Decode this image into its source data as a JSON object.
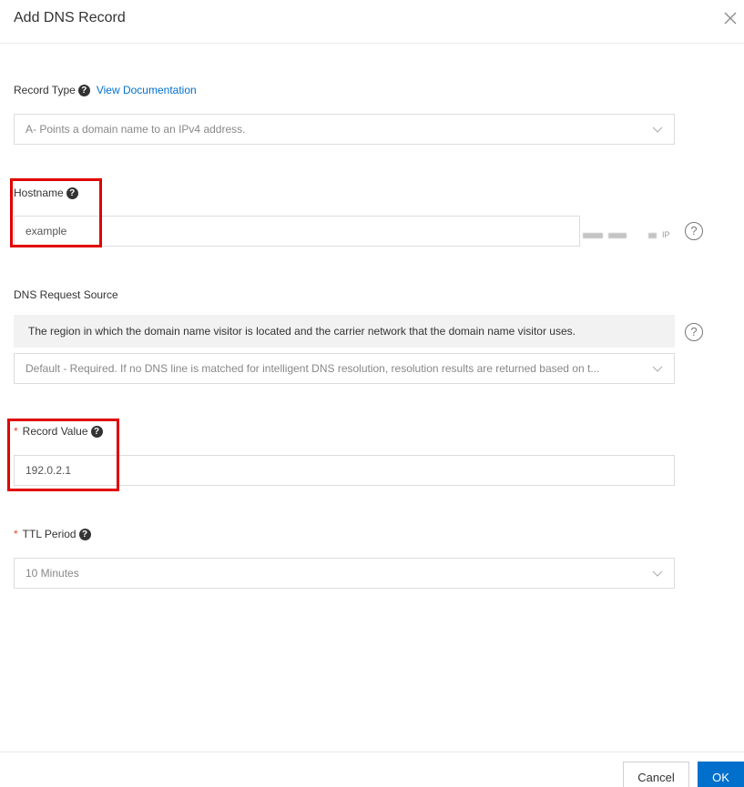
{
  "dialog": {
    "title": "Add DNS Record"
  },
  "record_type": {
    "label": "Record Type",
    "help_link": "View Documentation",
    "selected": "A- Points a domain name to an IPv4 address."
  },
  "hostname": {
    "label": "Hostname",
    "value": "example",
    "suffix": "IP"
  },
  "dns_request_source": {
    "label": "DNS Request Source",
    "info": "The region in which the domain name visitor is located and the carrier network that the domain name visitor uses.",
    "selected": "Default - Required. If no DNS line is matched for intelligent DNS resolution, resolution results are returned based on t..."
  },
  "record_value": {
    "required_mark": "*",
    "label": "Record Value",
    "value": "192.0.2.1"
  },
  "ttl": {
    "required_mark": "*",
    "label": "TTL Period",
    "selected": "10 Minutes"
  },
  "footer": {
    "cancel_label": "Cancel",
    "ok_label": "OK"
  },
  "icons": {
    "question_glyph": "?",
    "help_glyph": "?",
    "close": "close-icon",
    "chevron": "chevron-down-icon"
  },
  "colors": {
    "accent": "#0070cc",
    "required": "#f04134",
    "highlight": "#e00000"
  }
}
